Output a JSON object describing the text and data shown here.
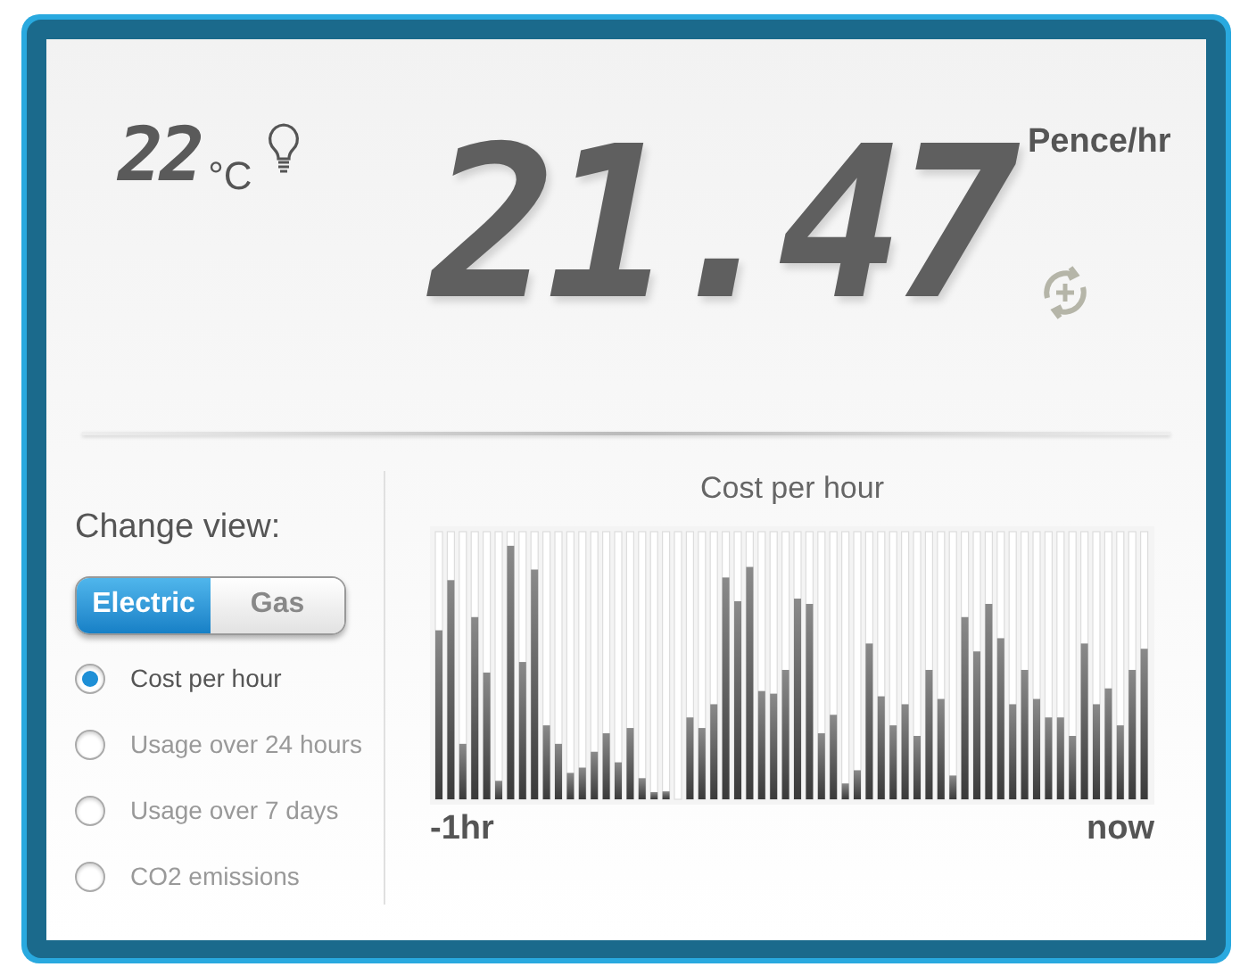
{
  "temperature": {
    "value": "22",
    "unit": "°C"
  },
  "reading": {
    "value": "21.47",
    "unit": "Pence/hr"
  },
  "change_view": {
    "label": "Change view:",
    "fuel_toggle": [
      {
        "label": "Electric",
        "selected": true
      },
      {
        "label": "Gas",
        "selected": false
      }
    ],
    "views": [
      {
        "label": "Cost per hour",
        "selected": true
      },
      {
        "label": "Usage over 24 hours",
        "selected": false
      },
      {
        "label": "Usage over 7 days",
        "selected": false
      },
      {
        "label": "CO2 emissions",
        "selected": false
      }
    ]
  },
  "chart": {
    "title": "Cost per hour",
    "x_start": "-1hr",
    "x_end": "now"
  }
}
